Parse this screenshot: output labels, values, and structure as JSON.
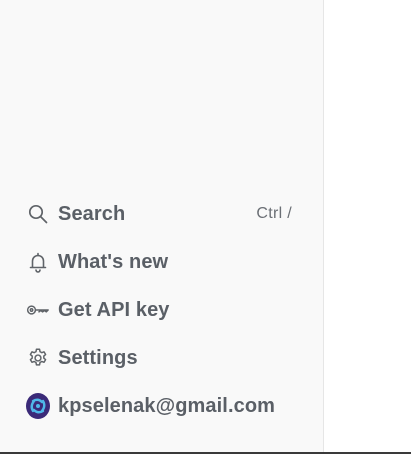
{
  "sidebar": {
    "items": [
      {
        "label": "Search",
        "icon": "search-icon",
        "shortcut": "Ctrl /"
      },
      {
        "label": "What's new",
        "icon": "bell-icon"
      },
      {
        "label": "Get API key",
        "icon": "key-icon"
      },
      {
        "label": "Settings",
        "icon": "gear-icon"
      }
    ],
    "account": {
      "email": "kpselenak@gmail.com",
      "icon": "avatar"
    }
  },
  "colors": {
    "sidebar_bg": "#f9f9f9",
    "text": "#5a5f66",
    "avatar_bg": "#3b2a78",
    "avatar_fg": "#4fb8e8"
  }
}
